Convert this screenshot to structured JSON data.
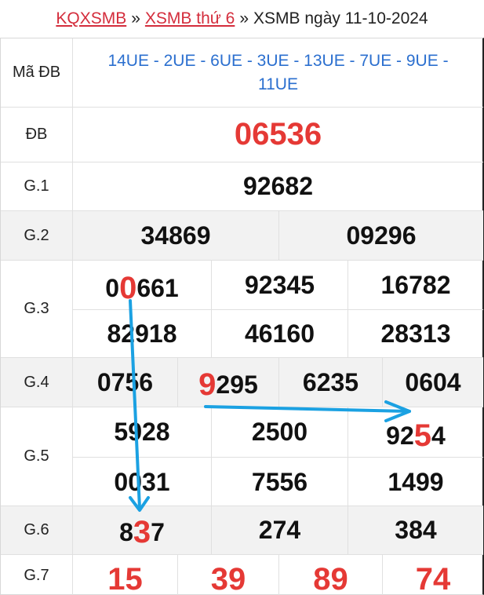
{
  "breadcrumb": {
    "home": "KQXSMB",
    "sep": "»",
    "day_link": "XSMB thứ 6",
    "current": "XSMB ngày 11-10-2024"
  },
  "labels": {
    "ma_db": "Mã ĐB",
    "db": "ĐB",
    "g1": "G.1",
    "g2": "G.2",
    "g3": "G.3",
    "g4": "G.4",
    "g5": "G.5",
    "g6": "G.6",
    "g7": "G.7"
  },
  "ma_db_codes": "14UE - 2UE - 6UE - 3UE - 13UE - 7UE - 9UE - 11UE",
  "db": "06536",
  "g1": "92682",
  "g2": [
    "34869",
    "09296"
  ],
  "g3": {
    "r1c1": {
      "a": "0",
      "hl": "0",
      "b": "661"
    },
    "r1c2": "92345",
    "r1c3": "16782",
    "r2": [
      "82918",
      "46160",
      "28313"
    ]
  },
  "g4": {
    "c1": "0756",
    "c2": {
      "hl": "9",
      "b": "295"
    },
    "c3": "6235",
    "c4": "0604"
  },
  "g5": {
    "r1c1": "5928",
    "r1c2": "2500",
    "r1c3": {
      "a": "92",
      "hl": "5",
      "b": "4"
    },
    "r2": [
      "0031",
      "7556",
      "1499"
    ]
  },
  "g6": {
    "c1": {
      "a": "8",
      "hl": "3",
      "b": "7"
    },
    "c2": "274",
    "c3": "384"
  },
  "g7": [
    "15",
    "39",
    "89",
    "74"
  ],
  "colors": {
    "highlight": "#e53935",
    "link": "#d42d3c",
    "codes": "#2b6fcf",
    "arrow": "#1ba1e2"
  }
}
